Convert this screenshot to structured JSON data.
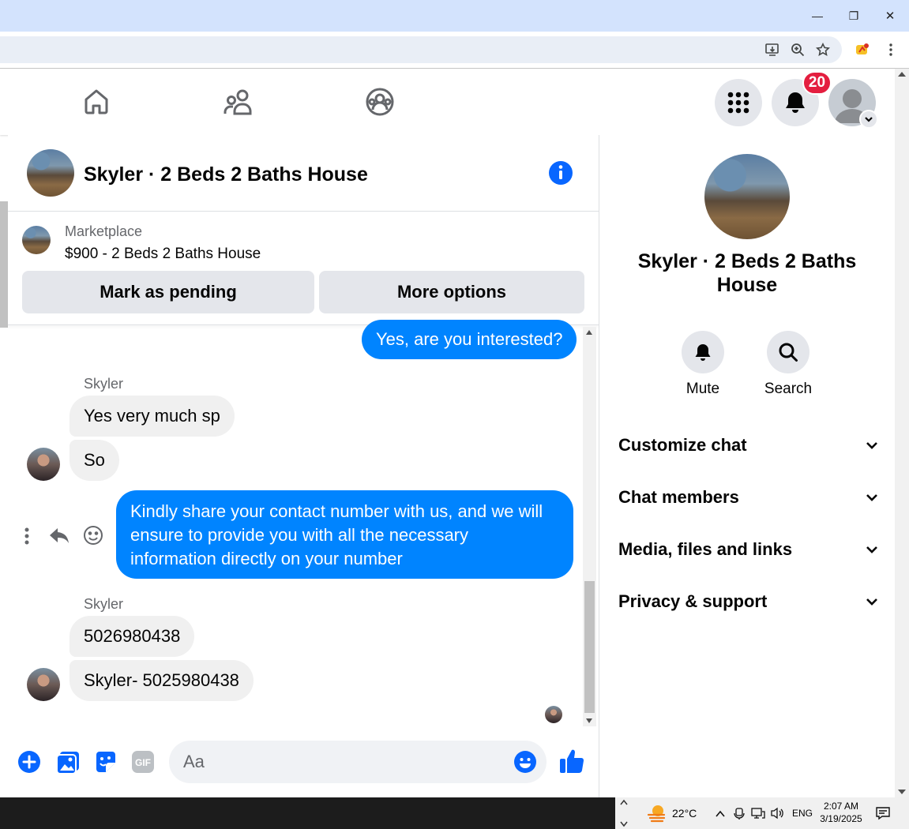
{
  "browser": {
    "window_controls": {
      "minimize": "—",
      "restore": "❐",
      "close": "✕"
    }
  },
  "nav": {
    "notifications_count": "20"
  },
  "chat": {
    "title": "Skyler · 2 Beds 2 Baths House"
  },
  "marketplace": {
    "label": "Marketplace",
    "item": "$900 - 2 Beds 2 Baths House",
    "mark_pending_label": "Mark as pending",
    "more_options_label": "More options"
  },
  "messages": {
    "m1": {
      "text": "Yes, are you interested?"
    },
    "g1": {
      "sender": "Skyler",
      "m2": "Yes very much sp",
      "m3": "So"
    },
    "m4": {
      "line1": "Kindly share your contact number with us, and we will",
      "line2": "ensure to provide you with all the necessary",
      "line3": "information directly on your number"
    },
    "g2": {
      "sender": "Skyler",
      "m5": "5026980438",
      "m6": "Skyler- 5025980438"
    }
  },
  "composer": {
    "placeholder": "Aa"
  },
  "right_panel": {
    "title": "Skyler · 2 Beds 2 Baths House",
    "mute_label": "Mute",
    "search_label": "Search",
    "sections": {
      "customize": "Customize chat",
      "members": "Chat members",
      "media": "Media, files and links",
      "privacy": "Privacy & support"
    }
  },
  "taskbar": {
    "weather": "22°C",
    "language": "ENG",
    "time": "2:07 AM",
    "date": "3/19/2025"
  },
  "colors": {
    "messenger_blue": "#0084ff",
    "fb_blue": "#0866ff",
    "badge_red": "#e41e3f"
  }
}
